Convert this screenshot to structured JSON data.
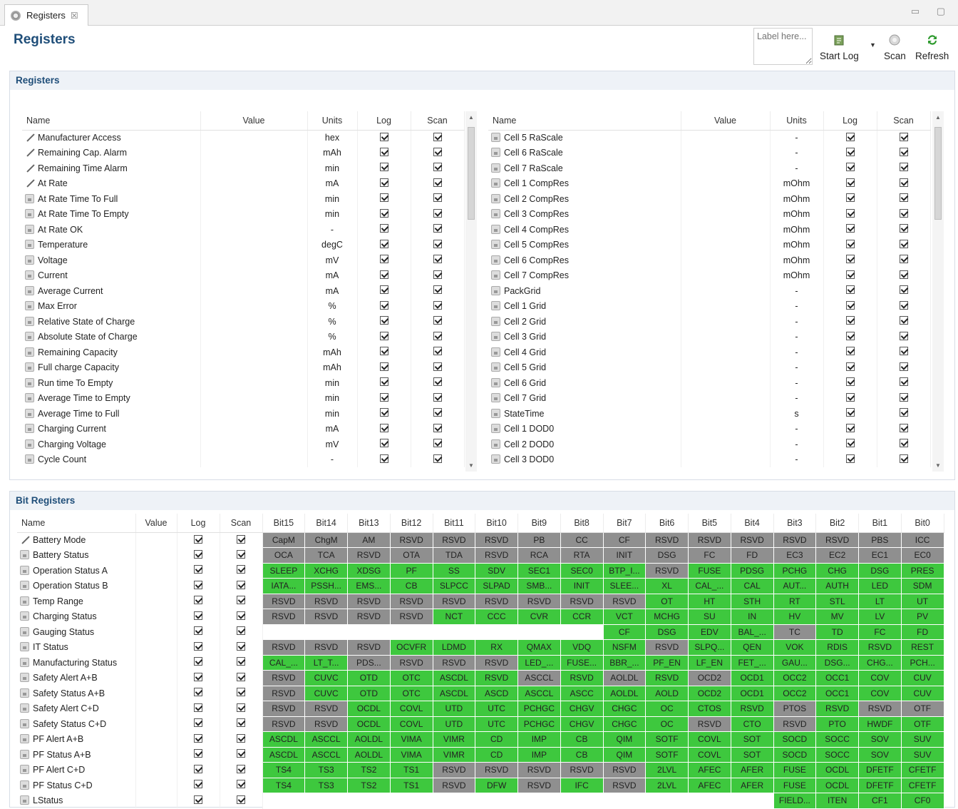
{
  "tab": {
    "title": "Registers",
    "close": "☒",
    "win_buttons": "▭ ▢"
  },
  "header": {
    "title": "Registers",
    "label_placeholder": "Label here...",
    "start_log": "Start Log",
    "scan": "Scan",
    "refresh": "Refresh"
  },
  "registers_section": {
    "title": "Registers"
  },
  "bit_section": {
    "title": "Bit Registers"
  },
  "reg_columns": {
    "name": "Name",
    "value": "Value",
    "units": "Units",
    "log": "Log",
    "scan": "Scan"
  },
  "left_registers": [
    {
      "icon": "pencil",
      "name": "Manufacturer Access",
      "value": "",
      "units": "hex"
    },
    {
      "icon": "pencil",
      "name": "Remaining Cap. Alarm",
      "value": "",
      "units": "mAh"
    },
    {
      "icon": "pencil",
      "name": "Remaining Time Alarm",
      "value": "",
      "units": "min"
    },
    {
      "icon": "pencil",
      "name": "At Rate",
      "value": "",
      "units": "mA"
    },
    {
      "icon": "lock",
      "name": "At Rate Time To Full",
      "value": "",
      "units": "min"
    },
    {
      "icon": "lock",
      "name": "At Rate Time To Empty",
      "value": "",
      "units": "min"
    },
    {
      "icon": "lock",
      "name": "At Rate OK",
      "value": "",
      "units": "-"
    },
    {
      "icon": "lock",
      "name": "Temperature",
      "value": "",
      "units": "degC"
    },
    {
      "icon": "lock",
      "name": "Voltage",
      "value": "",
      "units": "mV"
    },
    {
      "icon": "lock",
      "name": "Current",
      "value": "",
      "units": "mA"
    },
    {
      "icon": "lock",
      "name": "Average Current",
      "value": "",
      "units": "mA"
    },
    {
      "icon": "lock",
      "name": "Max Error",
      "value": "",
      "units": "%"
    },
    {
      "icon": "lock",
      "name": "Relative State of Charge",
      "value": "",
      "units": "%"
    },
    {
      "icon": "lock",
      "name": "Absolute State of Charge",
      "value": "",
      "units": "%"
    },
    {
      "icon": "lock",
      "name": "Remaining Capacity",
      "value": "",
      "units": "mAh"
    },
    {
      "icon": "lock",
      "name": "Full charge Capacity",
      "value": "",
      "units": "mAh"
    },
    {
      "icon": "lock",
      "name": "Run time To Empty",
      "value": "",
      "units": "min"
    },
    {
      "icon": "lock",
      "name": "Average Time to Empty",
      "value": "",
      "units": "min"
    },
    {
      "icon": "lock",
      "name": "Average Time to Full",
      "value": "",
      "units": "min"
    },
    {
      "icon": "lock",
      "name": "Charging Current",
      "value": "",
      "units": "mA"
    },
    {
      "icon": "lock",
      "name": "Charging Voltage",
      "value": "",
      "units": "mV"
    },
    {
      "icon": "lock",
      "name": "Cycle Count",
      "value": "",
      "units": "-"
    }
  ],
  "right_registers": [
    {
      "icon": "lock",
      "name": "Cell 5 RaScale",
      "value": "",
      "units": "-"
    },
    {
      "icon": "lock",
      "name": "Cell 6 RaScale",
      "value": "",
      "units": "-"
    },
    {
      "icon": "lock",
      "name": "Cell 7 RaScale",
      "value": "",
      "units": "-"
    },
    {
      "icon": "lock",
      "name": "Cell 1 CompRes",
      "value": "",
      "units": "mOhm"
    },
    {
      "icon": "lock",
      "name": "Cell 2 CompRes",
      "value": "",
      "units": "mOhm"
    },
    {
      "icon": "lock",
      "name": "Cell 3 CompRes",
      "value": "",
      "units": "mOhm"
    },
    {
      "icon": "lock",
      "name": "Cell 4 CompRes",
      "value": "",
      "units": "mOhm"
    },
    {
      "icon": "lock",
      "name": "Cell 5 CompRes",
      "value": "",
      "units": "mOhm"
    },
    {
      "icon": "lock",
      "name": "Cell 6 CompRes",
      "value": "",
      "units": "mOhm"
    },
    {
      "icon": "lock",
      "name": "Cell 7 CompRes",
      "value": "",
      "units": "mOhm"
    },
    {
      "icon": "lock",
      "name": "PackGrid",
      "value": "",
      "units": "-"
    },
    {
      "icon": "lock",
      "name": "Cell 1 Grid",
      "value": "",
      "units": "-"
    },
    {
      "icon": "lock",
      "name": "Cell 2 Grid",
      "value": "",
      "units": "-"
    },
    {
      "icon": "lock",
      "name": "Cell 3 Grid",
      "value": "",
      "units": "-"
    },
    {
      "icon": "lock",
      "name": "Cell 4 Grid",
      "value": "",
      "units": "-"
    },
    {
      "icon": "lock",
      "name": "Cell 5 Grid",
      "value": "",
      "units": "-"
    },
    {
      "icon": "lock",
      "name": "Cell 6 Grid",
      "value": "",
      "units": "-"
    },
    {
      "icon": "lock",
      "name": "Cell 7 Grid",
      "value": "",
      "units": "-"
    },
    {
      "icon": "lock",
      "name": "StateTime",
      "value": "",
      "units": "s"
    },
    {
      "icon": "lock",
      "name": "Cell 1 DOD0",
      "value": "",
      "units": "-"
    },
    {
      "icon": "lock",
      "name": "Cell 2 DOD0",
      "value": "",
      "units": "-"
    },
    {
      "icon": "lock",
      "name": "Cell 3 DOD0",
      "value": "",
      "units": "-"
    }
  ],
  "bit_columns": [
    "Name",
    "Value",
    "Log",
    "Scan",
    "Bit15",
    "Bit14",
    "Bit13",
    "Bit12",
    "Bit11",
    "Bit10",
    "Bit9",
    "Bit8",
    "Bit7",
    "Bit6",
    "Bit5",
    "Bit4",
    "Bit3",
    "Bit2",
    "Bit1",
    "Bit0"
  ],
  "bit_colors": {
    "green": "#3ec83e",
    "gray": "#8f8f8f"
  },
  "bit_registers": [
    {
      "icon": "pencil",
      "name": "Battery Mode",
      "value": "",
      "bits": [
        "CapM",
        "ChgM",
        "AM",
        "RSVD",
        "RSVD",
        "RSVD",
        "PB",
        "CC",
        "CF",
        "RSVD",
        "RSVD",
        "RSVD",
        "RSVD",
        "RSVD",
        "PBS",
        "ICC"
      ],
      "states": "xxxxxxxxxxxxxxxx"
    },
    {
      "icon": "lock",
      "name": "Battery Status",
      "value": "",
      "bits": [
        "OCA",
        "TCA",
        "RSVD",
        "OTA",
        "TDA",
        "RSVD",
        "RCA",
        "RTA",
        "INIT",
        "DSG",
        "FC",
        "FD",
        "EC3",
        "EC2",
        "EC1",
        "EC0"
      ],
      "states": "xxxxxxxxxxxxxxxx"
    },
    {
      "icon": "lock",
      "name": "Operation Status A",
      "value": "",
      "bits": [
        "SLEEP",
        "XCHG",
        "XDSG",
        "PF",
        "SS",
        "SDV",
        "SEC1",
        "SEC0",
        "BTP_I...",
        "RSVD",
        "FUSE",
        "PDSG",
        "PCHG",
        "CHG",
        "DSG",
        "PRES"
      ],
      "states": "gggggggggxgggggg"
    },
    {
      "icon": "lock",
      "name": "Operation Status B",
      "value": "",
      "bits": [
        "IATA...",
        "PSSH...",
        "EMS...",
        "CB",
        "SLPCC",
        "SLPAD",
        "SMB...",
        "INIT",
        "SLEE...",
        "XL",
        "CAL_...",
        "CAL",
        "AUT...",
        "AUTH",
        "LED",
        "SDM"
      ],
      "states": "gggggggggggggggg"
    },
    {
      "icon": "lock",
      "name": "Temp Range",
      "value": "",
      "bits": [
        "RSVD",
        "RSVD",
        "RSVD",
        "RSVD",
        "RSVD",
        "RSVD",
        "RSVD",
        "RSVD",
        "RSVD",
        "OT",
        "HT",
        "STH",
        "RT",
        "STL",
        "LT",
        "UT"
      ],
      "states": "xxxxxxxxxggggggg"
    },
    {
      "icon": "lock",
      "name": "Charging Status",
      "value": "",
      "bits": [
        "RSVD",
        "RSVD",
        "RSVD",
        "RSVD",
        "NCT",
        "CCC",
        "CVR",
        "CCR",
        "VCT",
        "MCHG",
        "SU",
        "IN",
        "HV",
        "MV",
        "LV",
        "PV"
      ],
      "states": "xxxxgggggggggggg"
    },
    {
      "icon": "lock",
      "name": "Gauging Status",
      "value": "",
      "bits": [
        "",
        "",
        "",
        "",
        "",
        "",
        "",
        "",
        "CF",
        "DSG",
        "EDV",
        "BAL_...",
        "TC",
        "TD",
        "FC",
        "FD"
      ],
      "states": "eeeeeeeeggggxggg"
    },
    {
      "icon": "lock",
      "name": "IT Status",
      "value": "",
      "bits": [
        "RSVD",
        "RSVD",
        "RSVD",
        "OCVFR",
        "LDMD",
        "RX",
        "QMAX",
        "VDQ",
        "NSFM",
        "RSVD",
        "SLPQ...",
        "QEN",
        "VOK",
        "RDIS",
        "RSVD",
        "REST"
      ],
      "states": "xxxggggggxgggggg"
    },
    {
      "icon": "lock",
      "name": "Manufacturing Status",
      "value": "",
      "bits": [
        "CAL_...",
        "LT_T...",
        "PDS...",
        "RSVD",
        "RSVD",
        "RSVD",
        "LED_...",
        "FUSE...",
        "BBR_...",
        "PF_EN",
        "LF_EN",
        "FET_...",
        "GAU...",
        "DSG...",
        "CHG...",
        "PCH..."
      ],
      "states": "ggxxxxggggggggggg"
    },
    {
      "icon": "lock",
      "name": "Safety Alert A+B",
      "value": "",
      "bits": [
        "RSVD",
        "CUVC",
        "OTD",
        "OTC",
        "ASCDL",
        "RSVD",
        "ASCCL",
        "RSVD",
        "AOLDL",
        "RSVD",
        "OCD2",
        "OCD1",
        "OCC2",
        "OCC1",
        "COV",
        "CUV"
      ],
      "states": "xgggggxgxgxggggg"
    },
    {
      "icon": "lock",
      "name": "Safety Status A+B",
      "value": "",
      "bits": [
        "RSVD",
        "CUVC",
        "OTD",
        "OTC",
        "ASCDL",
        "ASCD",
        "ASCCL",
        "ASCC",
        "AOLDL",
        "AOLD",
        "OCD2",
        "OCD1",
        "OCC2",
        "OCC1",
        "COV",
        "CUV"
      ],
      "states": "xggggggggggggggg"
    },
    {
      "icon": "lock",
      "name": "Safety Alert C+D",
      "value": "",
      "bits": [
        "RSVD",
        "RSVD",
        "OCDL",
        "COVL",
        "UTD",
        "UTC",
        "PCHGC",
        "CHGV",
        "CHGC",
        "OC",
        "CTOS",
        "RSVD",
        "PTOS",
        "RSVD",
        "RSVD",
        "OTF"
      ],
      "states": "xxggggggggggxgxxg"
    },
    {
      "icon": "lock",
      "name": "Safety Status C+D",
      "value": "",
      "bits": [
        "RSVD",
        "RSVD",
        "OCDL",
        "COVL",
        "UTD",
        "UTC",
        "PCHGC",
        "CHGV",
        "CHGC",
        "OC",
        "RSVD",
        "CTO",
        "RSVD",
        "PTO",
        "HWDF",
        "OTF"
      ],
      "states": "xxggggggggxgxggg"
    },
    {
      "icon": "lock",
      "name": "PF Alert A+B",
      "value": "",
      "bits": [
        "ASCDL",
        "ASCCL",
        "AOLDL",
        "VIMA",
        "VIMR",
        "CD",
        "IMP",
        "CB",
        "QIM",
        "SOTF",
        "COVL",
        "SOT",
        "SOCD",
        "SOCC",
        "SOV",
        "SUV"
      ],
      "states": "gggggggggggggggg"
    },
    {
      "icon": "lock",
      "name": "PF Status A+B",
      "value": "",
      "bits": [
        "ASCDL",
        "ASCCL",
        "AOLDL",
        "VIMA",
        "VIMR",
        "CD",
        "IMP",
        "CB",
        "QIM",
        "SOTF",
        "COVL",
        "SOT",
        "SOCD",
        "SOCC",
        "SOV",
        "SUV"
      ],
      "states": "gggggggggggggggg"
    },
    {
      "icon": "lock",
      "name": "PF Alert C+D",
      "value": "",
      "bits": [
        "TS4",
        "TS3",
        "TS2",
        "TS1",
        "RSVD",
        "RSVD",
        "RSVD",
        "RSVD",
        "RSVD",
        "2LVL",
        "AFEC",
        "AFER",
        "FUSE",
        "OCDL",
        "DFETF",
        "CFETF"
      ],
      "states": "ggggxxxxxggggggg"
    },
    {
      "icon": "lock",
      "name": "PF Status C+D",
      "value": "",
      "bits": [
        "TS4",
        "TS3",
        "TS2",
        "TS1",
        "RSVD",
        "DFW",
        "RSVD",
        "IFC",
        "RSVD",
        "2LVL",
        "AFEC",
        "AFER",
        "FUSE",
        "OCDL",
        "DFETF",
        "CFETF"
      ],
      "states": "ggggxgxgxggggggg"
    },
    {
      "icon": "lock",
      "name": "LStatus",
      "value": "",
      "bits": [
        "",
        "",
        "",
        "",
        "",
        "",
        "",
        "",
        "",
        "",
        "",
        "",
        "FIELD...",
        "ITEN",
        "CF1",
        "CF0"
      ],
      "states": "eeeeeeeeeeeegggg"
    }
  ]
}
